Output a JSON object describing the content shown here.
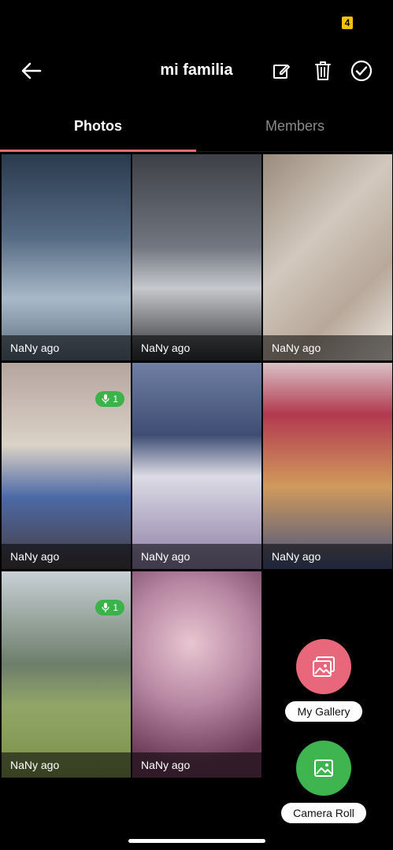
{
  "status": {
    "badge": "4"
  },
  "header": {
    "title": "mi familia"
  },
  "tabs": [
    {
      "label": "Photos"
    },
    {
      "label": "Members"
    }
  ],
  "photos": [
    {
      "caption": "NaNy ago"
    },
    {
      "caption": "NaNy ago"
    },
    {
      "caption": "NaNy ago"
    },
    {
      "caption": "NaNy ago",
      "voice_count": "1"
    },
    {
      "caption": "NaNy ago"
    },
    {
      "caption": "NaNy ago"
    },
    {
      "caption": "NaNy ago",
      "voice_count": "1"
    },
    {
      "caption": "NaNy ago"
    }
  ],
  "actions": {
    "gallery_label": "My Gallery",
    "camera_label": "Camera Roll"
  },
  "colors": {
    "tab_indicator": "#e36b73",
    "gallery_fab": "#e8677a",
    "camera_fab": "#3fb550",
    "voice_badge": "#3bb34a"
  }
}
